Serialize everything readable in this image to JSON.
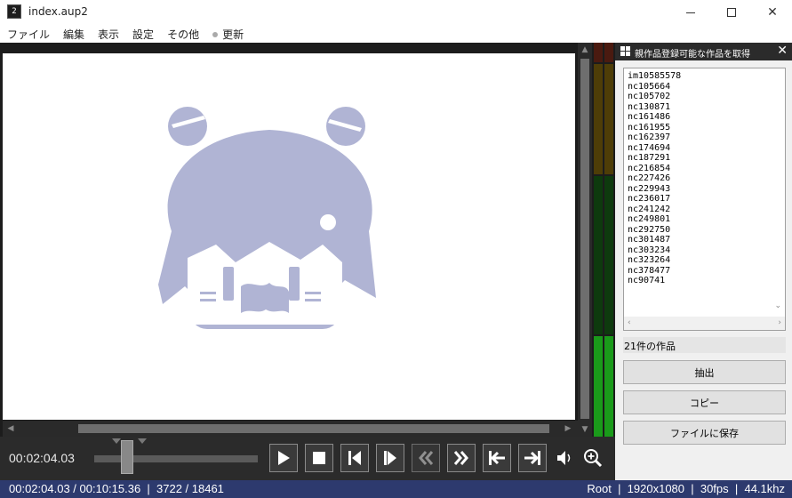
{
  "window": {
    "title": "index.aup2"
  },
  "menu": {
    "items": [
      "ファイル",
      "編集",
      "表示",
      "設定",
      "その他",
      "更新"
    ]
  },
  "transport": {
    "timecode": "00:02:04.03",
    "icons": [
      "play-icon",
      "stop-icon",
      "step-back-icon",
      "step-forward-icon",
      "rewind-icon",
      "fast-forward-icon",
      "go-to-start-icon",
      "go-to-end-icon",
      "volume-icon",
      "zoom-icon"
    ]
  },
  "status": {
    "left": "00:02:04.03 / 00:10:15.36  |  3722 / 18461",
    "right": "Root  |  1920x1080  |  30fps  |  44.1khz"
  },
  "panel": {
    "title": "親作品登録可能な作品を取得",
    "items": [
      "im10585578",
      "nc105664",
      "nc105702",
      "nc130871",
      "nc161486",
      "nc161955",
      "nc162397",
      "nc174694",
      "nc187291",
      "nc216854",
      "nc227426",
      "nc229943",
      "nc236017",
      "nc241242",
      "nc249801",
      "nc292750",
      "nc301487",
      "nc303234",
      "nc323264",
      "nc378477",
      "nc90741"
    ],
    "count_label": "21件の作品",
    "extract_button": "抽出",
    "copy_button": "コピー",
    "save_button": "ファイルに保存"
  },
  "colors": {
    "statusbar": "#2d3a6e",
    "character": "#b0b4d4",
    "meter_green": "#1a9a1a",
    "meter_olive": "#4e3d07"
  }
}
